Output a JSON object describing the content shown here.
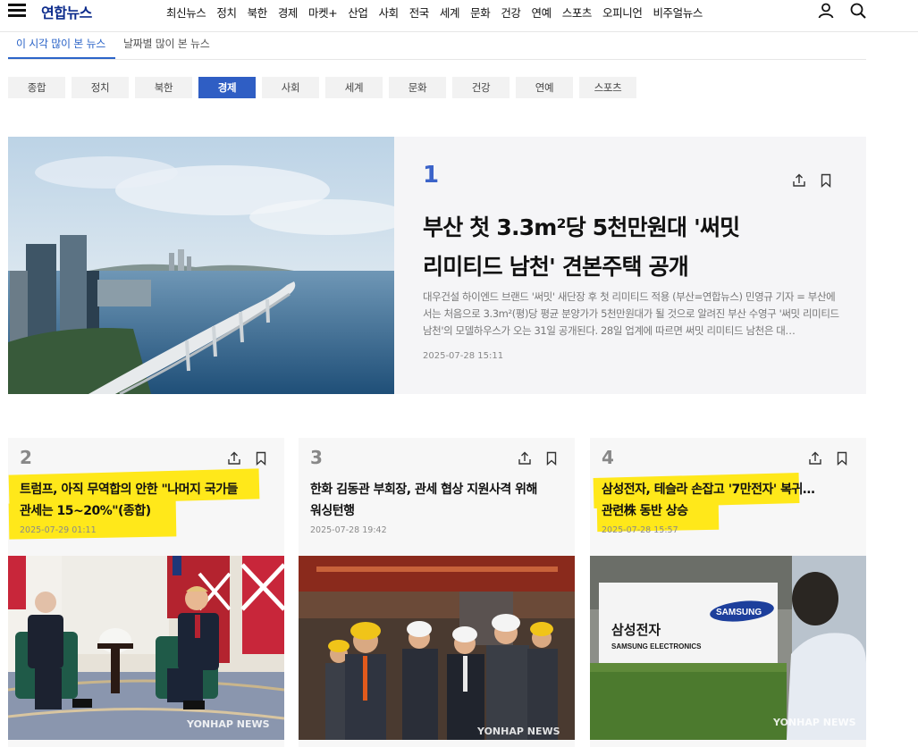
{
  "header": {
    "logo": "연합뉴스",
    "nav": [
      "최신뉴스",
      "정치",
      "북한",
      "경제",
      "마켓+",
      "산업",
      "사회",
      "전국",
      "세계",
      "문화",
      "건강",
      "연예",
      "스포츠",
      "오피니언",
      "비주얼뉴스"
    ]
  },
  "view_tabs": {
    "active": "이 시각 많이 본 뉴스",
    "other": "날짜별 많이 본 뉴스"
  },
  "categories": {
    "items": [
      "종합",
      "정치",
      "북한",
      "경제",
      "사회",
      "세계",
      "문화",
      "건강",
      "연예",
      "스포츠"
    ],
    "active": "경제"
  },
  "feature": {
    "rank": "1",
    "title_line1": "부산 첫 3.3m²당 5천만원대 '써밋",
    "title_line2": "리미티드 남천' 견본주택 공개",
    "summary": "대우건설 하이엔드 브랜드 '써밋' 새단장 후 첫 리미티드 적용 (부산=연합뉴스) 민영규 기자 = 부산에서는 처음으로 3.3m²(평)당 평균 분양가가 5천만원대가 될 것으로 알려진 부산 수영구 '써밋 리미티드 남천'의 모델하우스가 오는 31일 공개된다. 28일 업계에 따르면 써밋 리미티드 남천은 대…",
    "date": "2025-07-28 15:11"
  },
  "cards": [
    {
      "rank": "2",
      "title_line1": "트럼프, 아직 무역합의 안한 \"나머지 국가들",
      "title_line2": "관세는 15~20%\"(종합)",
      "date": "2025-07-29 01:11",
      "watermark": "YONHAP NEWS"
    },
    {
      "rank": "3",
      "title_line1": "한화 김동관 부회장, 관세 협상 지원사격 위해",
      "title_line2": "워싱턴행",
      "date": "2025-07-28 19:42",
      "watermark": "YONHAP NEWS"
    },
    {
      "rank": "4",
      "title_line1": "삼성전자, 테슬라 손잡고 '7만전자' 복귀…",
      "title_line2": "관련株 동반 상승",
      "date": "2025-07-28 15:57",
      "sign_ko": "삼성전자",
      "sign_en": "SAMSUNG ELECTRONICS",
      "sign_logo": "SAMSUNG",
      "watermark": "YONHAP NEWS"
    }
  ],
  "colors": {
    "accent": "#2f5ec4",
    "rank_blue": "#3b63c9",
    "highlight": "#ffe81a"
  },
  "icons": [
    "menu-icon",
    "user-icon",
    "search-icon",
    "share-icon",
    "bookmark-icon"
  ]
}
